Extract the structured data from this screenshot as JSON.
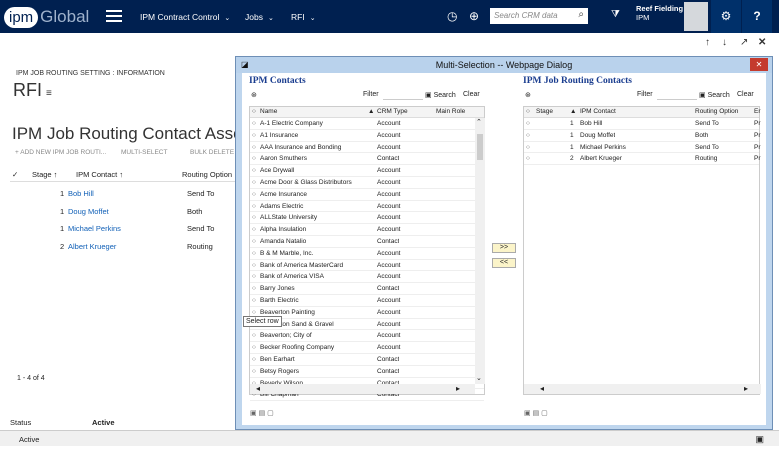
{
  "topbar": {
    "logo_ipm": "ipm",
    "logo_global": "Global",
    "nav": [
      {
        "label": "IPM Contract Control"
      },
      {
        "label": "Jobs"
      },
      {
        "label": "RFI"
      }
    ],
    "search_placeholder": "Search CRM data",
    "user_name": "Reef Fielding",
    "user_org": "IPM"
  },
  "page": {
    "form_label": "IPM JOB ROUTING SETTING : INFORMATION",
    "title": "RFI",
    "section_title": "IPM Job Routing Contact Associations",
    "commands": [
      "+ ADD NEW IPM JOB ROUTI...",
      "MULTI-SELECT",
      "BULK DELETE"
    ],
    "grid_headers": [
      "Stage ↑",
      "IPM Contact ↑",
      "Routing Option"
    ],
    "rows": [
      {
        "stage": "1",
        "contact": "Bob Hill",
        "option": "Send To"
      },
      {
        "stage": "1",
        "contact": "Doug Moffet",
        "option": "Both"
      },
      {
        "stage": "1",
        "contact": "Michael Perkins",
        "option": "Send To"
      },
      {
        "stage": "2",
        "contact": "Albert Krueger",
        "option": "Routing"
      }
    ],
    "count": "1 - 4 of 4",
    "status_label": "Status",
    "status_value": "Active",
    "footer_status": "Active"
  },
  "dialog": {
    "title": "Multi-Selection -- Webpage Dialog",
    "left_title": "IPM Contacts",
    "right_title": "IPM Job Routing Contacts",
    "filter_label": "Filter",
    "search_label": "Search",
    "clear_label": "Clear",
    "left_headers": [
      "Name",
      "CRM Type",
      "Main Role"
    ],
    "left_rows": [
      {
        "name": "A-1 Electric Company",
        "type": "Account"
      },
      {
        "name": "A1 Insurance",
        "type": "Account"
      },
      {
        "name": "AAA Insurance and Bonding",
        "type": "Account"
      },
      {
        "name": "Aaron Smuthers",
        "type": "Contact"
      },
      {
        "name": "Ace Drywall",
        "type": "Account"
      },
      {
        "name": "Acme Door & Glass Distributors",
        "type": "Account"
      },
      {
        "name": "Acme Insurance",
        "type": "Account"
      },
      {
        "name": "Adams Electric",
        "type": "Account"
      },
      {
        "name": "ALLState University",
        "type": "Account"
      },
      {
        "name": "Alpha Insulation",
        "type": "Account"
      },
      {
        "name": "Amanda Natalio",
        "type": "Contact"
      },
      {
        "name": "B & M Marble, Inc.",
        "type": "Account"
      },
      {
        "name": "Bank of America MasterCard",
        "type": "Account"
      },
      {
        "name": "Bank of America VISA",
        "type": "Account"
      },
      {
        "name": "Barry Jones",
        "type": "Contact"
      },
      {
        "name": "Barth Electric",
        "type": "Account"
      },
      {
        "name": "Beaverton Painting",
        "type": "Account"
      },
      {
        "name": "Beaverton Sand & Gravel",
        "type": "Account"
      },
      {
        "name": "Beaverton; City of",
        "type": "Account"
      },
      {
        "name": "Becker Roofing Company",
        "type": "Account"
      },
      {
        "name": "Ben Earhart",
        "type": "Contact"
      },
      {
        "name": "Betsy Rogers",
        "type": "Contact"
      },
      {
        "name": "Beverly Wilson",
        "type": "Contact"
      },
      {
        "name": "Bill Chapman",
        "type": "Contact"
      }
    ],
    "right_headers": [
      "Stage",
      "IPM Contact",
      "Routing Option",
      "Er"
    ],
    "right_rows": [
      {
        "stage": "1",
        "contact": "Bob Hill",
        "option": "Send To",
        "er": "Pr"
      },
      {
        "stage": "1",
        "contact": "Doug Moffet",
        "option": "Both",
        "er": "Pr"
      },
      {
        "stage": "1",
        "contact": "Michael Perkins",
        "option": "Send To",
        "er": "Pr"
      },
      {
        "stage": "2",
        "contact": "Albert Krueger",
        "option": "Routing",
        "er": "Pr"
      }
    ],
    "add_label": ">>",
    "remove_label": "<<",
    "tooltip": "Select row"
  }
}
